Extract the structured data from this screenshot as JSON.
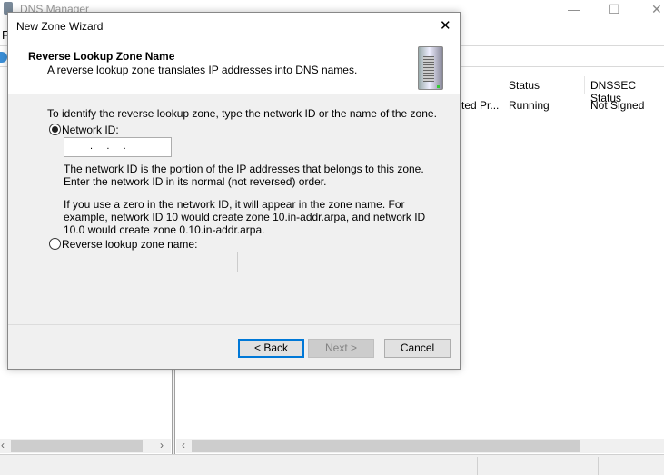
{
  "main_window": {
    "title": "DNS Manager",
    "menu_first": "F",
    "columns": [
      "Status",
      "DNSSEC Status"
    ],
    "row": {
      "type_truncated": "ted Pr...",
      "status": "Running",
      "dnssec": "Not Signed"
    }
  },
  "dialog": {
    "title": "New Zone Wizard",
    "header_title": "Reverse Lookup Zone Name",
    "header_subtitle": "A reverse lookup zone translates IP addresses into DNS names.",
    "instruction": "To identify the reverse lookup zone, type the network ID or the name of the zone.",
    "option_network_id": "Network ID:",
    "network_id_value": ".     .     .",
    "help1": "The network ID is the portion of the IP addresses that belongs to this zone. Enter the network ID in its normal (not reversed) order.",
    "help2": "If you use a zero in the network ID, it will appear in the zone name. For example, network ID 10 would create zone 10.in-addr.arpa, and network ID 10.0 would create zone 0.10.in-addr.arpa.",
    "option_zone_name": "Reverse lookup zone name:",
    "zone_name_value": "",
    "selected_option": "network_id",
    "buttons": {
      "back": "< Back",
      "next": "Next >",
      "cancel": "Cancel"
    }
  }
}
